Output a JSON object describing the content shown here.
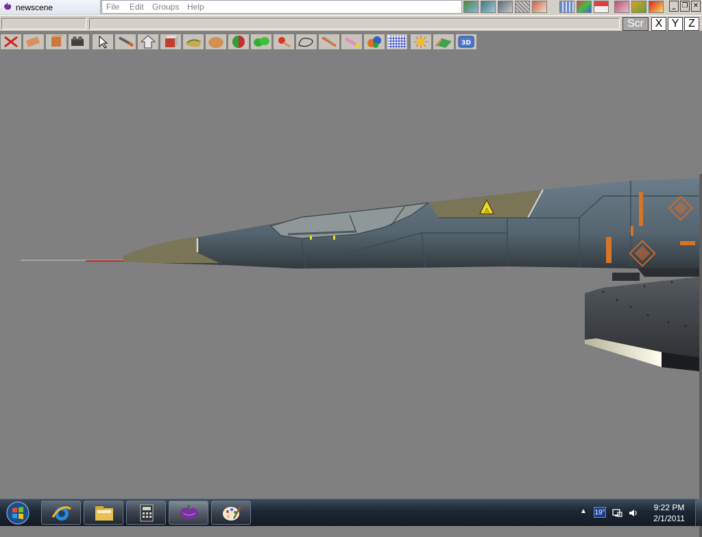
{
  "window": {
    "title": "newscene",
    "app_icon": "bell-pepper-icon"
  },
  "menu": {
    "items": [
      "File",
      "Edit",
      "Groups",
      "Help"
    ]
  },
  "view_buttons": {
    "scr": "Scr",
    "x": "X",
    "y": "Y",
    "z": "Z"
  },
  "top_icons": [
    "landscape-icon",
    "wave-icon",
    "tools-icon",
    "grid-icon",
    "branch-icon",
    "map-icon",
    "terrain-color-icon",
    "house-icon",
    "picture-icon",
    "brush-icon",
    "help-icon"
  ],
  "window_controls": {
    "minimize": "_",
    "restore": "❐",
    "close": "✕"
  },
  "toolbar_tools": [
    "delete-icon",
    "move-icon",
    "box-icon",
    "camera-icon",
    "select-arrow-icon",
    "pencil-icon",
    "extrude-icon",
    "cube-icon",
    "surface-icon",
    "sphere-icon",
    "material-icon",
    "blob-icon",
    "paint-icon",
    "curve-icon",
    "knife-icon",
    "brush-icon",
    "group-icon",
    "grid-icon",
    "light-icon",
    "terrain-icon",
    "3d-view-icon"
  ],
  "toolbar_3d_label": "3D",
  "taskbar": {
    "apps": [
      {
        "name": "internet-explorer-icon",
        "active": false
      },
      {
        "name": "file-explorer-icon",
        "active": false
      },
      {
        "name": "calculator-icon",
        "active": false
      },
      {
        "name": "bell-pepper-icon",
        "active": true
      },
      {
        "name": "paint-palette-icon",
        "active": false
      }
    ],
    "tray": {
      "expand": "▲",
      "temperature": "19°",
      "time": "9:22 PM",
      "date": "2/1/2011"
    }
  },
  "viewport": {
    "background": "#808080",
    "warning_symbol": "⚠"
  },
  "colors": {
    "fuselage": "#5a6b78",
    "nose": "#7a7556",
    "accent_orange": "#d87428"
  }
}
